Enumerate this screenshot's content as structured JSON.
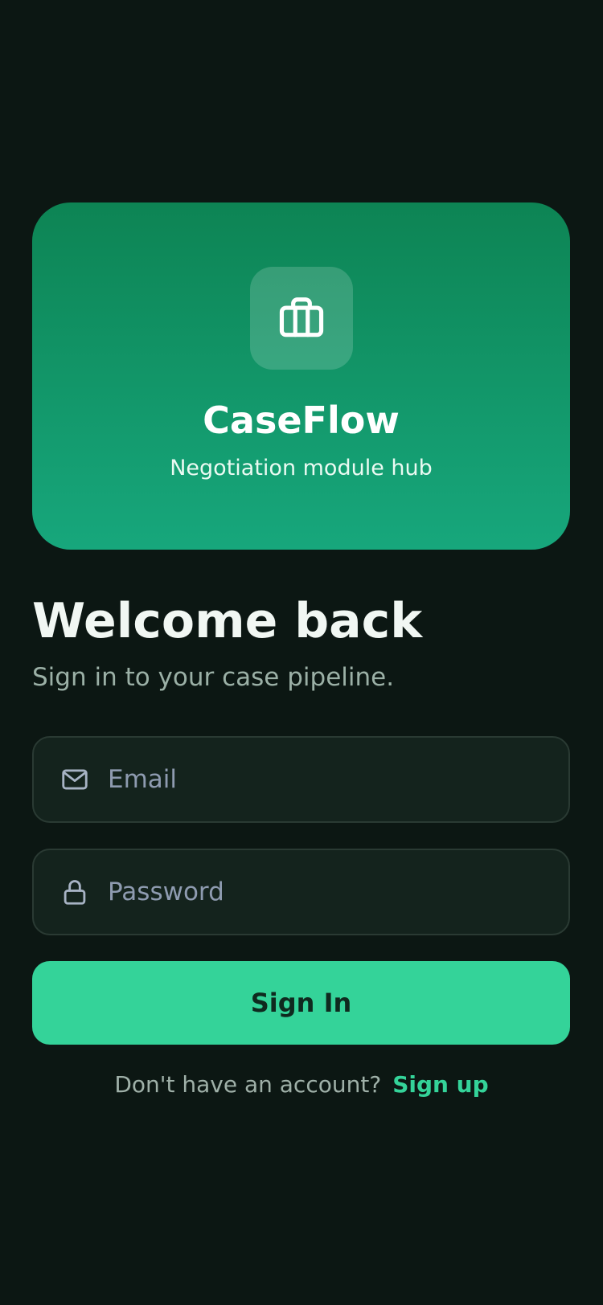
{
  "hero": {
    "icon": "briefcase-icon",
    "title": "CaseFlow",
    "subtitle": "Negotiation module hub"
  },
  "welcome": {
    "heading": "Welcome back",
    "subheading": "Sign in to your case pipeline."
  },
  "form": {
    "email": {
      "icon": "mail-icon",
      "placeholder": "Email",
      "value": ""
    },
    "password": {
      "icon": "lock-icon",
      "placeholder": "Password",
      "value": ""
    },
    "submit_label": "Sign In"
  },
  "signup": {
    "prompt": "Don't have an account?",
    "link_label": "Sign up"
  },
  "colors": {
    "background": "#0c1713",
    "hero_gradient_top": "#0d8454",
    "hero_gradient_bottom": "#17a77c",
    "accent": "#34d399",
    "field_background": "#14231d",
    "field_border": "#2a3a33"
  }
}
